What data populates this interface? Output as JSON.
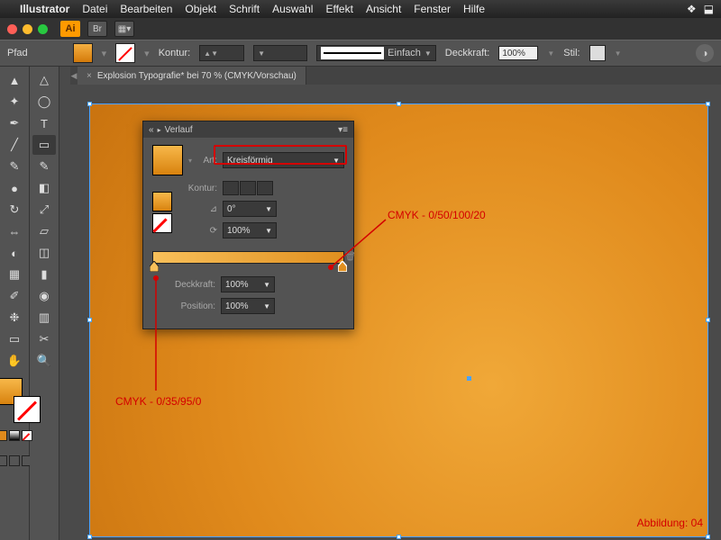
{
  "menubar": {
    "app": "Illustrator",
    "items": [
      "Datei",
      "Bearbeiten",
      "Objekt",
      "Schrift",
      "Auswahl",
      "Effekt",
      "Ansicht",
      "Fenster",
      "Hilfe"
    ]
  },
  "titlebar": {
    "ai": "Ai",
    "br": "Br"
  },
  "controlbar": {
    "object_label": "Pfad",
    "kontur_label": "Kontur:",
    "kontur_value": "",
    "stroke_style": "Einfach",
    "deckkraft_label": "Deckkraft:",
    "deckkraft_value": "100%",
    "stil_label": "Stil:"
  },
  "document": {
    "tab_title": "Explosion Typografie* bei 70 % (CMYK/Vorschau)"
  },
  "gradient_panel": {
    "title": "Verlauf",
    "art_label": "Art:",
    "art_value": "Kreisförmig",
    "kontur_label": "Kontur:",
    "angle_value": "0°",
    "aspect_value": "100%",
    "deckkraft_label": "Deckkraft:",
    "deckkraft_value": "100%",
    "position_label": "Position:",
    "position_value": "100%"
  },
  "annotations": {
    "right_stop": "CMYK - 0/50/100/20",
    "left_stop": "CMYK - 0/35/95/0",
    "figure": "Abbildung: 04"
  }
}
